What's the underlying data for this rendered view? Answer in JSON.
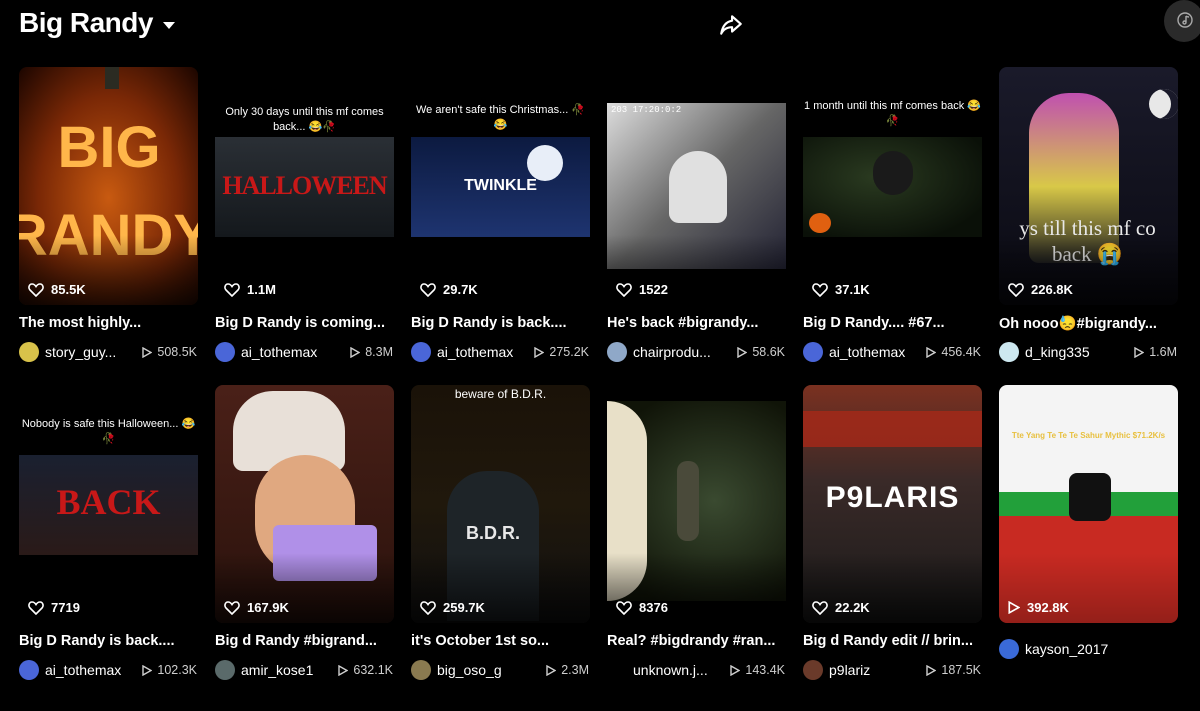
{
  "header": {
    "title": "Big Randy",
    "share_icon": "share-arrow-icon",
    "corner_icon": "tiktok-note-icon"
  },
  "row1": [
    {
      "likes": "85.5K",
      "caption": "The most highly...",
      "user": "story_guy...",
      "views": "508.5K",
      "avatar_color": "#d8c24a"
    },
    {
      "likes": "1.1M",
      "caption": "Big D Randy is coming...",
      "user": "ai_tothemax",
      "views": "8.3M",
      "avatar_color": "#4a66d8",
      "overlay_text": "Only 30 days until this mf comes back... 😂🥀",
      "thumb_text": "HALLOWEEN"
    },
    {
      "likes": "29.7K",
      "caption": "Big D Randy is back....",
      "user": "ai_tothemax",
      "views": "275.2K",
      "avatar_color": "#4a66d8",
      "overlay_text": "We aren't safe this Christmas... 🥀😂",
      "thumb_text": "TWINKLE"
    },
    {
      "likes": "1522",
      "caption": "He's back #bigrandy...",
      "user": "chairprodu...",
      "views": "58.6K",
      "avatar_color": "#8fa8c8",
      "thumb_text": "203 17:20:0:2"
    },
    {
      "likes": "37.1K",
      "caption": "Big D Randy.... #67...",
      "user": "ai_tothemax",
      "views": "456.4K",
      "avatar_color": "#4a66d8",
      "overlay_text": "1 month until this mf comes back 😂🥀"
    },
    {
      "likes": "226.8K",
      "caption": "Oh nooo😓#bigrandy...",
      "user": "d_king335",
      "views": "1.6M",
      "avatar_color": "#cde8f0",
      "thumb_text": "ys till this mf co back 😭"
    }
  ],
  "row2": [
    {
      "likes": "7719",
      "caption": "Big D Randy is back....",
      "user": "ai_tothemax",
      "views": "102.3K",
      "avatar_color": "#4a66d8",
      "overlay_text": "Nobody is safe this Halloween... 😂🥀",
      "thumb_text": "BACK"
    },
    {
      "likes": "167.9K",
      "caption": "Big d Randy #bigrand...",
      "user": "amir_kose1",
      "views": "632.1K",
      "avatar_color": "#5a6a6a"
    },
    {
      "likes": "259.7K",
      "caption": "it's October 1st so...",
      "user": "big_oso_g",
      "views": "2.3M",
      "avatar_color": "#8a7a50",
      "overlay_text": "beware of B.D.R.",
      "thumb_text": "B.D.R."
    },
    {
      "likes": "8376",
      "caption": "Real? #bigdrandy #ran...",
      "user": "unknown.j...",
      "views": "143.4K",
      "avatar_color": "#000000"
    },
    {
      "likes": "22.2K",
      "caption": "Big d Randy edit // brin...",
      "user": "p9lariz",
      "views": "187.5K",
      "avatar_color": "#6a3a2a",
      "thumb_text": "P9LARIS"
    },
    {
      "likes": "392.8K",
      "caption": "",
      "user": "kayson_2017",
      "views": "",
      "avatar_color": "#3a6ad8",
      "overlay_text": "Tte Yang Te Te Te Sahur Mythic $71.2K/s"
    }
  ],
  "colors": {
    "background": "#000000",
    "secondary_text": "#cfcfcf",
    "corner_button": "#2a2a2a"
  }
}
